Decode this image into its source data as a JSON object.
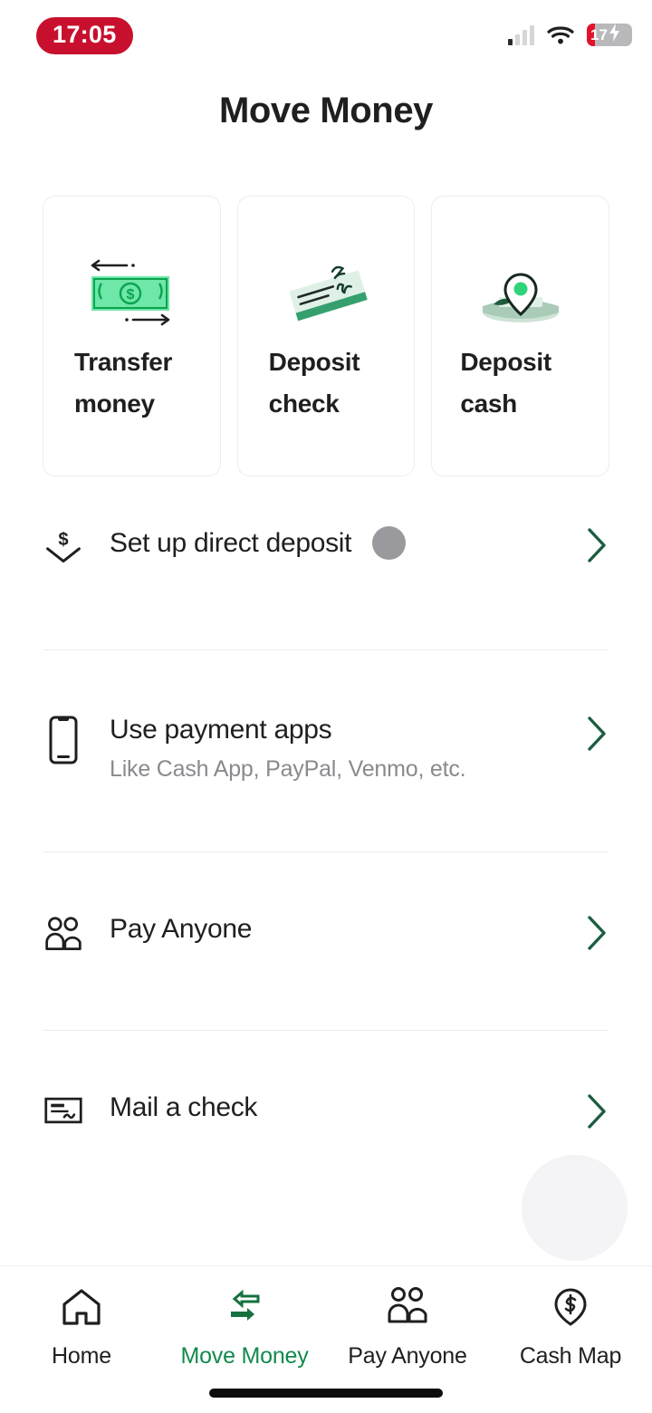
{
  "status_bar": {
    "time": "17:05",
    "time_pill_color": "#c8102e",
    "battery_level": "17",
    "battery_charging": true,
    "signal_icon": "cellular-signal-icon",
    "wifi_icon": "wifi-icon",
    "battery_icon": "battery-icon"
  },
  "header": {
    "title": "Move Money"
  },
  "cards": [
    {
      "label": "Transfer money",
      "icon": "transfer-money-illustration"
    },
    {
      "label": "Deposit check",
      "icon": "deposit-check-illustration"
    },
    {
      "label": "Deposit cash",
      "icon": "deposit-cash-illustration"
    }
  ],
  "list": [
    {
      "title": "Set up direct deposit",
      "subtitle": "",
      "icon": "dollar-download-icon",
      "badge": true,
      "badge_color": "#9a9a9e",
      "chevron": "chevron-right-icon"
    },
    {
      "title": "Use payment apps",
      "subtitle": "Like Cash App, PayPal, Venmo, etc.",
      "icon": "mobile-phone-icon",
      "badge": false,
      "chevron": "chevron-right-icon"
    },
    {
      "title": "Pay Anyone",
      "subtitle": "",
      "icon": "two-people-icon",
      "badge": false,
      "chevron": "chevron-right-icon"
    },
    {
      "title": "Mail a check",
      "subtitle": "",
      "icon": "check-document-icon",
      "badge": false,
      "chevron": "chevron-right-icon"
    }
  ],
  "floating_button": {
    "name": "floating-action-button",
    "color": "#f4f4f6"
  },
  "bottom_nav": {
    "active_color": "#128a4d",
    "items": [
      {
        "label": "Home",
        "icon": "home-icon",
        "active": false
      },
      {
        "label": "Move Money",
        "icon": "swap-arrows-icon",
        "active": true
      },
      {
        "label": "Pay Anyone",
        "icon": "two-people-icon",
        "active": false
      },
      {
        "label": "Cash Map",
        "icon": "map-pin-dollar-icon",
        "active": false
      }
    ]
  }
}
